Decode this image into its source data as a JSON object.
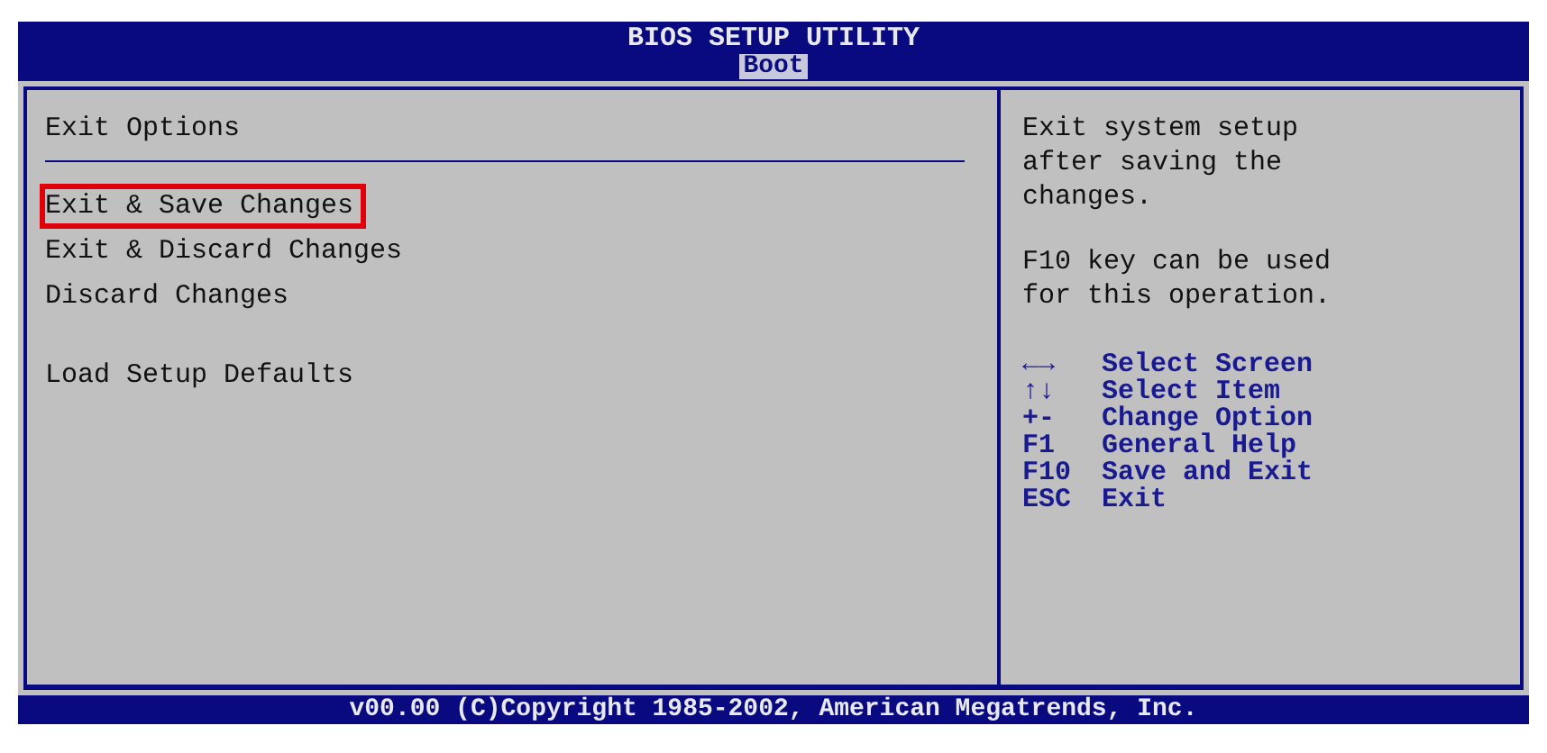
{
  "window": {
    "title": "BIOS SETUP UTILITY"
  },
  "tabs": [
    {
      "label": "Boot",
      "selected": true
    }
  ],
  "main": {
    "heading": "Exit Options",
    "items": [
      {
        "label": "Exit & Save Changes",
        "selected": true
      },
      {
        "label": "Exit & Discard Changes",
        "selected": false
      },
      {
        "label": "Discard Changes",
        "selected": false
      },
      {
        "label": "Load Setup Defaults",
        "selected": false,
        "gap_before": true
      }
    ]
  },
  "help": {
    "paragraphs": [
      "Exit system setup after saving the changes.",
      "F10 key can be used for this operation."
    ],
    "keys": [
      {
        "key": "←→",
        "action": "Select Screen"
      },
      {
        "key": "↑↓",
        "action": "Select Item"
      },
      {
        "key": "+-",
        "action": "Change Option"
      },
      {
        "key": "F1",
        "action": "General Help"
      },
      {
        "key": "F10",
        "action": "Save and Exit"
      },
      {
        "key": "ESC",
        "action": "Exit"
      }
    ]
  },
  "status_bar": "v00.00 (C)Copyright 1985-2002, American Megatrends, Inc."
}
